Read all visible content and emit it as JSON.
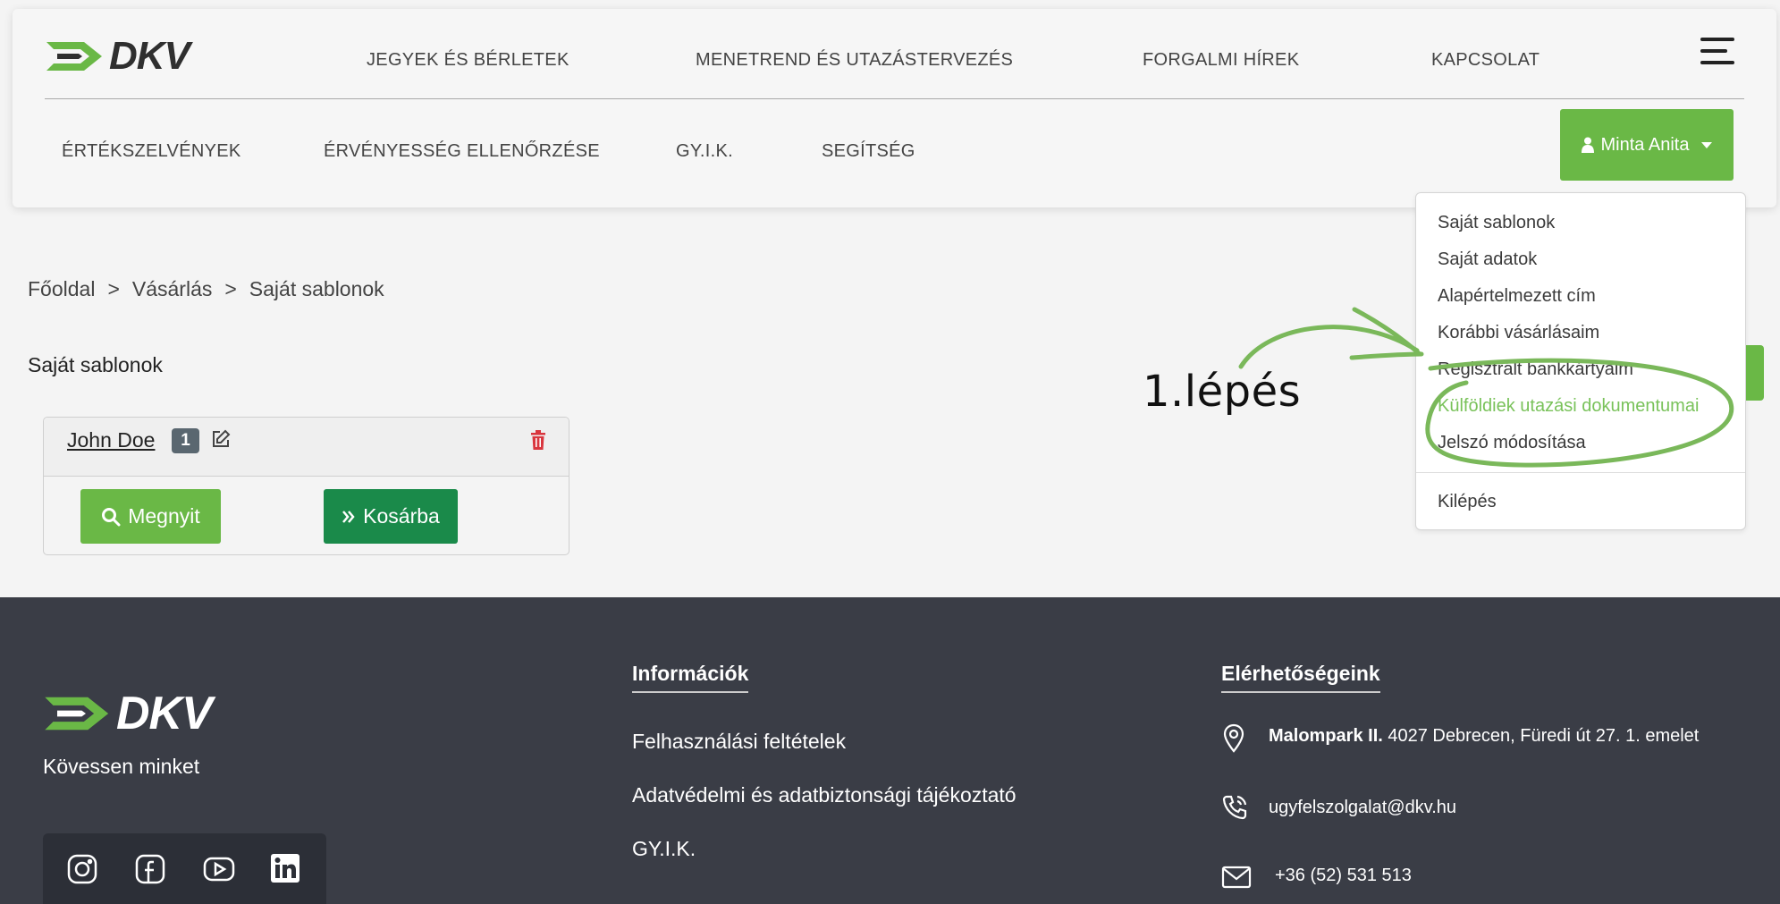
{
  "header": {
    "logo": "DKV",
    "nav": [
      "JEGYEK ÉS BÉRLETEK",
      "MENETREND ÉS UTAZÁSTERVEZÉS",
      "FORGALMI HÍREK",
      "KAPCSOLAT"
    ],
    "subnav": [
      "ÉRTÉKSZELVÉNYEK",
      "ÉRVÉNYESSÉG ELLENŐRZÉSE",
      "GY.I.K.",
      "SEGÍTSÉG"
    ],
    "user_name": "Minta Anita"
  },
  "dropdown": {
    "items": [
      "Saját sablonok",
      "Saját adatok",
      "Alapértelmezett cím",
      "Korábbi vásárlásaim",
      "Regisztrált bankkártyáim",
      "Külföldiek utazási dokumentumai",
      "Jelszó módosítása"
    ],
    "logout": "Kilépés",
    "active_index": 5
  },
  "annotation": {
    "text": "1.lépés"
  },
  "breadcrumb": [
    "Főoldal",
    "Vásárlás",
    "Saját sablonok"
  ],
  "breadcrumb_sep": ">",
  "page_title": "Saját sablonok",
  "template_card": {
    "name": "John Doe",
    "badge": "1",
    "open_label": "Megnyit",
    "cart_label": "Kosárba"
  },
  "footer": {
    "logo": "DKV",
    "follow": "Kövessen minket",
    "info_heading": "Információk",
    "info_links": [
      "Felhasználási feltételek",
      "Adatvédelmi és adatbiztonsági tájékoztató",
      "GY.I.K."
    ],
    "contact_heading": "Elérhetőségeink",
    "address_bold": "Malompark II.",
    "address_rest": " 4027 Debrecen, Füredi út 27. 1. emelet",
    "email": "ugyfelszolgalat@dkv.hu",
    "phone": "+36 (52) 531 513"
  },
  "colors": {
    "brand_green": "#6ab846",
    "dark_green": "#1a8a4a",
    "footer_bg": "#3a3d46",
    "annotation_green": "#7ab85a",
    "delete_red": "#d9363e"
  }
}
